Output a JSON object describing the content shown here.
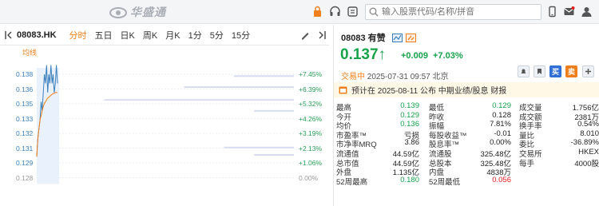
{
  "topbar": {
    "logo_text": "华盛通",
    "search_placeholder": "输入股票代码/名称/拼音",
    "icons": [
      "lock-icon",
      "headset-icon",
      "notice-icon",
      "mobile-icon",
      "gift-icon",
      "mail-icon",
      "user-icon"
    ]
  },
  "toolbar": {
    "code": "08083.HK",
    "timeframes": [
      "分时",
      "五日",
      "日K",
      "周K",
      "月K",
      "1分",
      "5分",
      "15分"
    ],
    "active": "分时"
  },
  "chart_data": {
    "type": "line",
    "legend": "均线",
    "y_ticks": [
      "0.138",
      "0.136",
      "0.135",
      "0.133",
      "0.132",
      "0.131",
      "0.129",
      "0.128"
    ],
    "right_ticks": [
      "+7.45%",
      "+6.39%",
      "+5.32%",
      "+4.26%",
      "+3.19%",
      "+2.13%",
      "+1.06%",
      "0.00%"
    ],
    "ylim": [
      0.128,
      0.138
    ],
    "price_series": [
      0.129,
      0.131,
      0.132,
      0.133,
      0.135,
      0.134,
      0.136,
      0.138,
      0.137,
      0.139,
      0.136,
      0.138,
      0.137,
      0.139,
      0.137,
      0.138,
      0.136,
      0.137,
      0.139,
      0.137
    ],
    "avg_series": [
      0.129,
      0.131,
      0.132,
      0.133,
      0.1335,
      0.134,
      0.1345,
      0.1348,
      0.135,
      0.1352,
      0.1354,
      0.1355,
      0.1356,
      0.1357,
      0.1358,
      0.1359,
      0.1359,
      0.136,
      0.136,
      0.136
    ],
    "volume_profile": [
      {
        "price": 0.1378,
        "amount": 0.3
      },
      {
        "price": 0.1366,
        "amount": 0.55
      },
      {
        "price": 0.1352,
        "amount": 0.95
      },
      {
        "price": 0.134,
        "amount": 0.2
      },
      {
        "price": 0.13,
        "amount": 0.35
      },
      {
        "price": 0.1292,
        "amount": 0.2
      }
    ]
  },
  "stock": {
    "code": "08083",
    "name": "有赞",
    "price": "0.137↑",
    "change": "+0.009",
    "change_pct": "+7.03%",
    "status": "交易中",
    "time": "2025-07-31 09:57 北京",
    "buttons": {
      "buy": "买",
      "sell": "卖"
    },
    "notice": "预计在 2025-08-11 公布 中期业绩/股息 财报"
  },
  "quote_rows": [
    [
      [
        "最高",
        "0.139",
        "green"
      ],
      [
        "最低",
        "0.129",
        "green"
      ],
      [
        "成交量",
        "1.756亿",
        ""
      ]
    ],
    [
      [
        "今开",
        "0.129",
        "green"
      ],
      [
        "昨收",
        "0.128",
        ""
      ],
      [
        "成交额",
        "2381万",
        ""
      ]
    ],
    [
      [
        "均价",
        "0.136",
        "green"
      ],
      [
        "振幅",
        "7.81%",
        ""
      ],
      [
        "换手率",
        "0.54%",
        ""
      ]
    ],
    [
      [
        "市盈率™",
        "亏损",
        ""
      ],
      [
        "每股收益™",
        "-0.01",
        ""
      ],
      [
        "量比",
        "8.010",
        ""
      ]
    ],
    [
      [
        "市净率MRQ",
        "3.86",
        ""
      ],
      [
        "股息率™",
        "0.00%",
        ""
      ],
      [
        "委比",
        "-36.89%",
        ""
      ]
    ],
    [
      [
        "流通值",
        "44.59亿",
        ""
      ],
      [
        "流通股",
        "325.48亿",
        ""
      ],
      [
        "交易所",
        "HKEX",
        ""
      ]
    ],
    [
      [
        "总市值",
        "44.59亿",
        ""
      ],
      [
        "总股本",
        "325.48亿",
        ""
      ],
      [
        "每手",
        "4000股",
        ""
      ]
    ],
    [
      [
        "外盘",
        "1.135亿",
        ""
      ],
      [
        "内盘",
        "4838万",
        ""
      ],
      [
        "",
        "",
        " "
      ]
    ],
    [
      [
        "52周最高",
        "0.180",
        "green"
      ],
      [
        "52周最低",
        "0.056",
        "red"
      ],
      [
        "",
        "",
        ""
      ]
    ]
  ],
  "colors": {
    "up": "#16a34a",
    "down": "#e11d1d",
    "accent": "#ef7f1a",
    "blue": "#3a7fbd"
  }
}
